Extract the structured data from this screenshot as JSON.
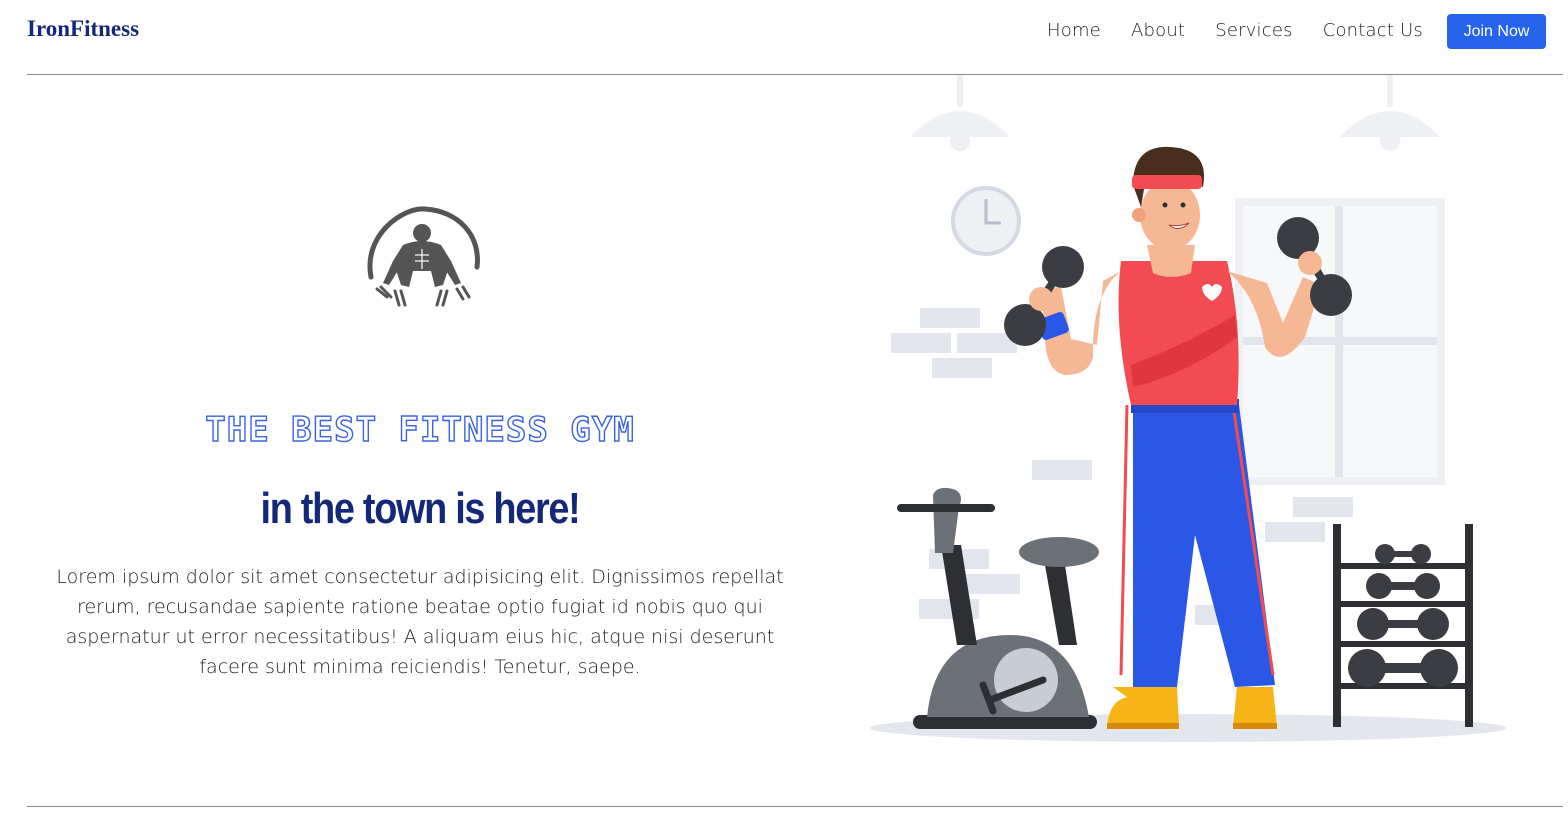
{
  "nav": {
    "brand": "IronFitness",
    "links": [
      "Home",
      "About",
      "Services",
      "Contact Us"
    ],
    "cta": "Join Now"
  },
  "hero": {
    "headline": "THE BEST FITNESS GYM",
    "subheadline": "in the town is here!",
    "description": "Lorem ipsum dolor sit amet consectetur adipisicing elit. Dignissimos repellat rerum, recusandae sapiente ratione beatae optio fugiat id nobis quo qui aspernatur ut error necessitatibus! A aliquam eius hic, atque nisi deserunt facere sunt minima reiciendis! Tenetur, saepe."
  },
  "icons": {
    "logo": "bodybuilder-logo-icon",
    "illustration": "man-lifting-dumbbells-illustration"
  },
  "colors": {
    "brand": "#14287a",
    "accent": "#2563eb",
    "headline_stroke": "#3b63e0",
    "shirt": "#f24b52",
    "pants": "#2a57e6"
  }
}
